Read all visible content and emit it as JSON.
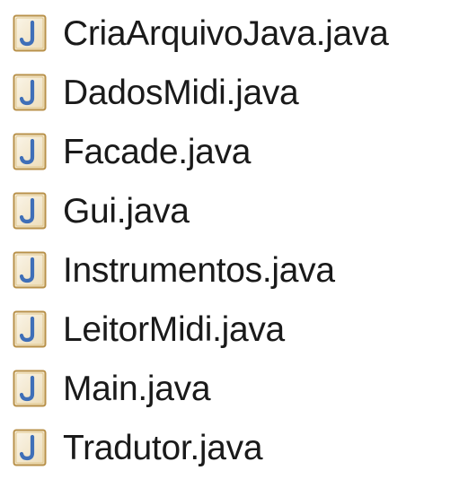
{
  "files": [
    {
      "name": "CriaArquivoJava.java",
      "icon": "java-file-icon"
    },
    {
      "name": "DadosMidi.java",
      "icon": "java-file-icon"
    },
    {
      "name": "Facade.java",
      "icon": "java-file-icon"
    },
    {
      "name": "Gui.java",
      "icon": "java-file-icon"
    },
    {
      "name": "Instrumentos.java",
      "icon": "java-file-icon"
    },
    {
      "name": "LeitorMidi.java",
      "icon": "java-file-icon"
    },
    {
      "name": "Main.java",
      "icon": "java-file-icon"
    },
    {
      "name": "Tradutor.java",
      "icon": "java-file-icon"
    }
  ],
  "colors": {
    "icon_frame": "#c9a45a",
    "icon_fill": "#f6edd8",
    "icon_letter": "#3f6fb8",
    "text": "#1a1a1a"
  }
}
